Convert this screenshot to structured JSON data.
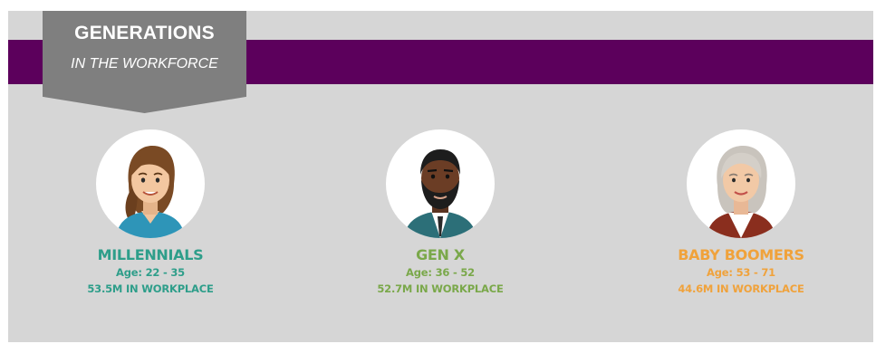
{
  "banner": {
    "title": "GENERATIONS",
    "subtitle": "IN THE WORKFORCE"
  },
  "colors": {
    "panel": "#d6d6d6",
    "band": "#5c005c",
    "banner": "#7f7f7f",
    "millennials": "#2e9e8a",
    "gen_x": "#7aa84a",
    "baby_boomers": "#f0a23b"
  },
  "generations": [
    {
      "name": "MILLENNIALS",
      "age": "Age: 22 - 35",
      "workplace": "53.5M IN WORKPLACE",
      "avatar": "young-woman-avatar-icon"
    },
    {
      "name": "GEN X",
      "age": "Age: 36 - 52",
      "workplace": "52.7M IN WORKPLACE",
      "avatar": "bearded-man-avatar-icon"
    },
    {
      "name": "BABY BOOMERS",
      "age": "Age: 53 - 71",
      "workplace": "44.6M IN WORKPLACE",
      "avatar": "older-woman-avatar-icon"
    }
  ]
}
